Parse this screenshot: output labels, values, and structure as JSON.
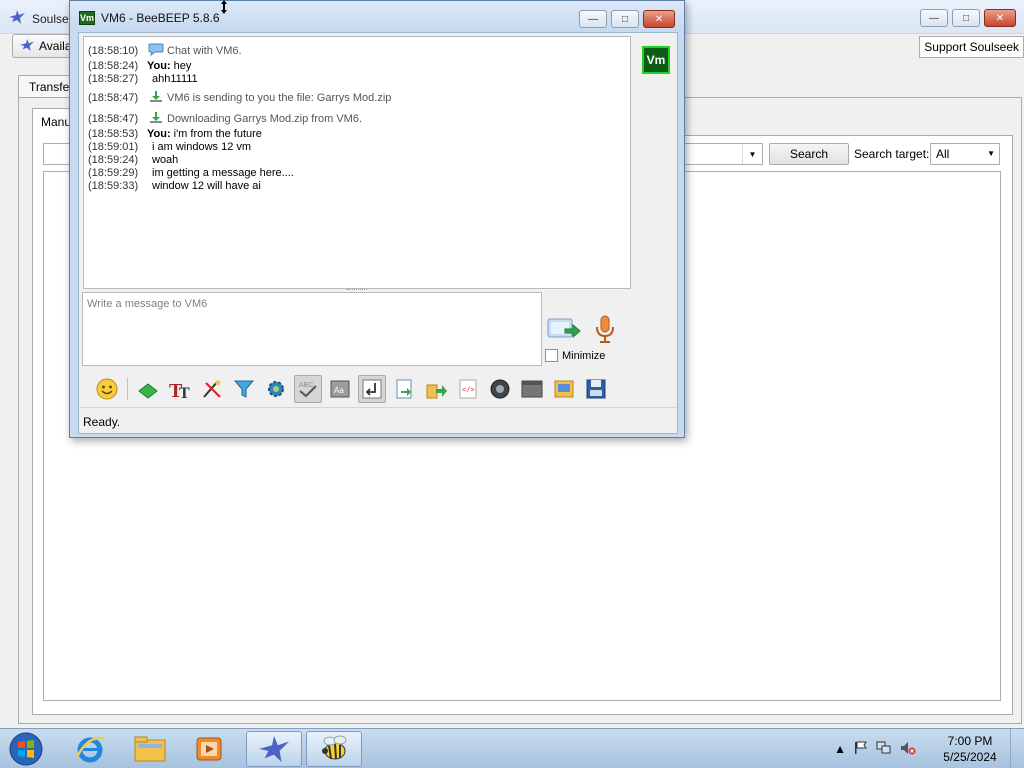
{
  "soulseek": {
    "title": "Soulseek",
    "status_label": "Available",
    "support_label": "Support Soulseek",
    "tab_label": "Transfers",
    "subtab_label": "Manual",
    "search_button": "Search",
    "search_target_label": "Search target:",
    "search_target_value": "All",
    "search_query": ""
  },
  "beebeep": {
    "title": "VM6 - BeeBEEP 5.8.6",
    "avatar_text": "Vm",
    "chat": [
      {
        "time": "(18:58:10)",
        "kind": "system",
        "icon": "chat-bubble-icon",
        "text": "Chat with VM6."
      },
      {
        "time": "(18:58:24)",
        "kind": "you",
        "sender": "You:",
        "text": "hey"
      },
      {
        "time": "(18:58:27)",
        "kind": "peer",
        "text": "ahh11111"
      },
      {
        "time": "(18:58:47)",
        "kind": "system",
        "icon": "file-transfer-icon",
        "text": "VM6 is sending to you the file: Garrys Mod.zip"
      },
      {
        "time": "(18:58:47)",
        "kind": "system",
        "icon": "file-transfer-icon",
        "text": "Downloading Garrys Mod.zip from VM6."
      },
      {
        "time": "(18:58:53)",
        "kind": "you",
        "sender": "You:",
        "text": "i'm from the future"
      },
      {
        "time": "(18:59:01)",
        "kind": "peer",
        "text": "i am windows 12 vm"
      },
      {
        "time": "(18:59:24)",
        "kind": "peer",
        "text": "woah"
      },
      {
        "time": "(18:59:29)",
        "kind": "peer",
        "text": "im getting a message here...."
      },
      {
        "time": "(18:59:33)",
        "kind": "peer",
        "text": "window 12 will have ai"
      }
    ],
    "compose_placeholder": "Write a message to VM6",
    "minimize_label": "Minimize",
    "minimize_checked": false,
    "status_text": "Ready.",
    "toolbar_icons": [
      "emoticon-icon",
      "separator",
      "text-color-icon",
      "font-icon",
      "draw-icon",
      "filter-icon",
      "settings-icon",
      "spellcheck-icon",
      "word-complete-icon",
      "return-key-icon",
      "save-chat-icon",
      "share-file-icon",
      "html-icon",
      "screenshot-icon",
      "tray-icon",
      "notes-icon",
      "save-icon"
    ]
  },
  "taskbar": {
    "apps": [
      "internet-explorer-icon",
      "file-explorer-icon",
      "media-player-icon",
      "soulseek-icon",
      "beebeep-icon"
    ],
    "time": "7:00 PM",
    "date": "5/25/2024"
  },
  "colors": {
    "avatar_bg": "#0b5c14",
    "avatar_border": "#25d025",
    "close_button": "#c6442d"
  }
}
